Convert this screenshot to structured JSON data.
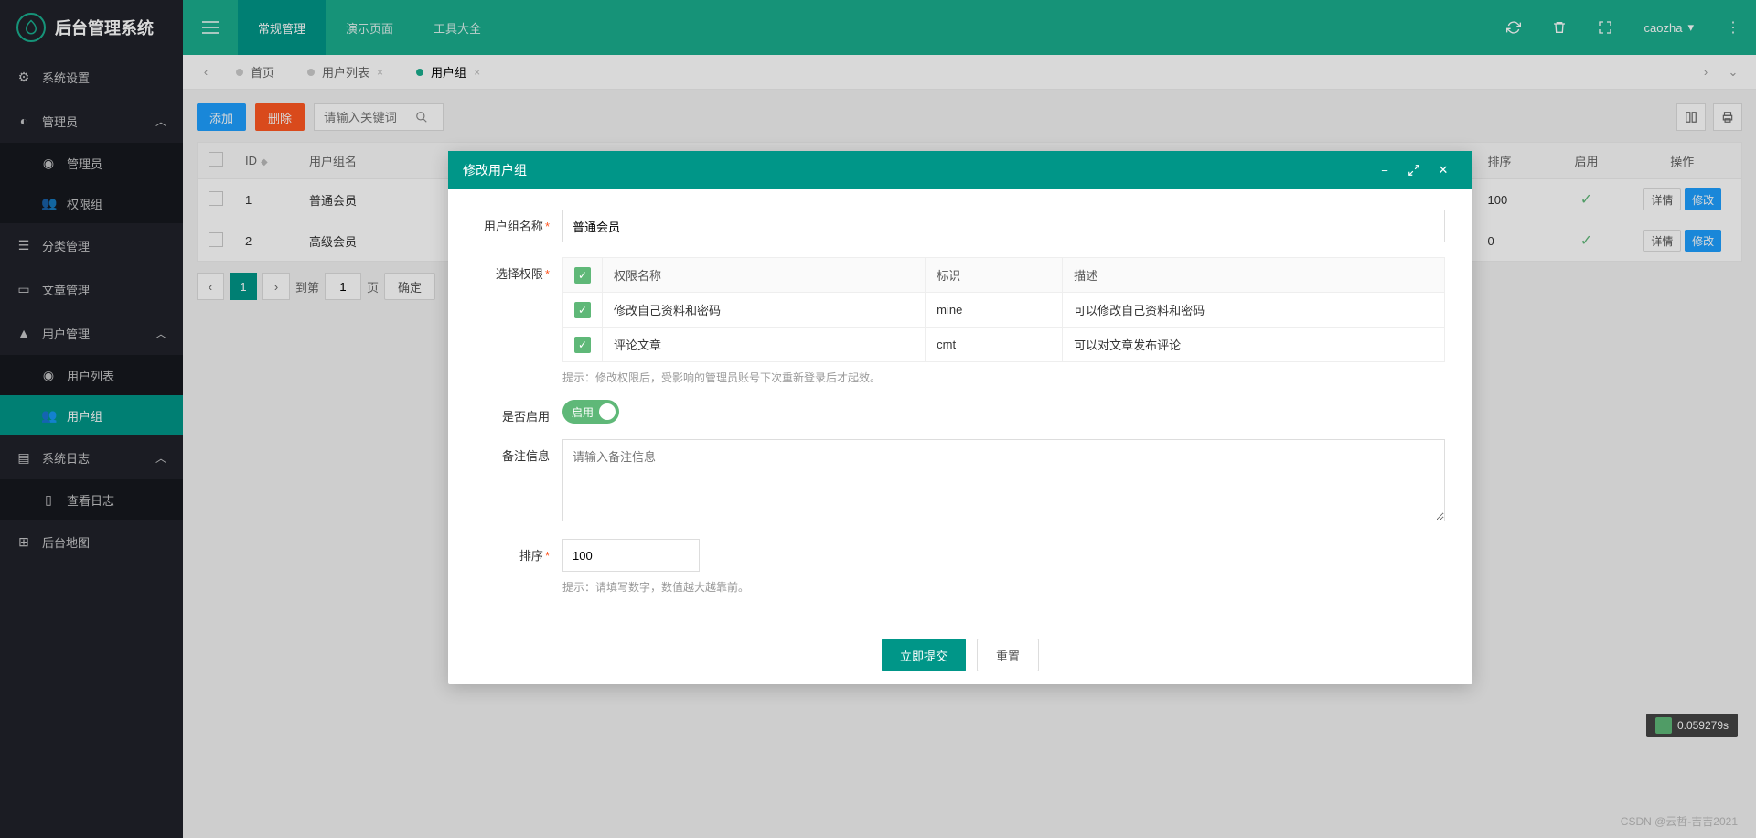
{
  "app": {
    "title": "后台管理系统"
  },
  "header": {
    "nav": [
      "常规管理",
      "演示页面",
      "工具大全"
    ],
    "user": "caozha"
  },
  "sidebar": {
    "items": [
      {
        "label": "系统设置",
        "icon": "gear"
      },
      {
        "label": "管理员",
        "icon": "user-circle",
        "expanded": true,
        "children": [
          {
            "label": "管理员"
          },
          {
            "label": "权限组"
          }
        ]
      },
      {
        "label": "分类管理",
        "icon": "list"
      },
      {
        "label": "文章管理",
        "icon": "doc"
      },
      {
        "label": "用户管理",
        "icon": "user",
        "expanded": true,
        "children": [
          {
            "label": "用户列表"
          },
          {
            "label": "用户组",
            "active": true
          }
        ]
      },
      {
        "label": "系统日志",
        "icon": "file",
        "expanded": true,
        "children": [
          {
            "label": "查看日志"
          }
        ]
      },
      {
        "label": "后台地图",
        "icon": "map"
      }
    ]
  },
  "tabs": {
    "items": [
      {
        "label": "首页",
        "closable": false
      },
      {
        "label": "用户列表",
        "closable": true
      },
      {
        "label": "用户组",
        "closable": true,
        "active": true
      }
    ]
  },
  "toolbar": {
    "add": "添加",
    "delete": "删除",
    "search_placeholder": "请输入关键词"
  },
  "table": {
    "headers": {
      "id": "ID",
      "name": "用户组名",
      "sort": "排序",
      "enabled": "启用",
      "ops": "操作"
    },
    "rows": [
      {
        "id": "1",
        "name": "普通会员",
        "sort": "100"
      },
      {
        "id": "2",
        "name": "高级会员",
        "sort": "0"
      }
    ],
    "ops": {
      "detail": "详情",
      "edit": "修改"
    }
  },
  "pagination": {
    "current": "1",
    "to": "到第",
    "page_unit": "页",
    "confirm": "确定"
  },
  "modal": {
    "title": "修改用户组",
    "labels": {
      "name": "用户组名称",
      "perm": "选择权限",
      "enabled": "是否启用",
      "remark": "备注信息",
      "sort": "排序"
    },
    "name_value": "普通会员",
    "perm_headers": {
      "name": "权限名称",
      "ident": "标识",
      "desc": "描述"
    },
    "perms": [
      {
        "name": "修改自己资料和密码",
        "ident": "mine",
        "desc": "可以修改自己资料和密码"
      },
      {
        "name": "评论文章",
        "ident": "cmt",
        "desc": "可以对文章发布评论"
      }
    ],
    "perm_hint": "提示：修改权限后，受影响的管理员账号下次重新登录后才起效。",
    "switch_on": "启用",
    "remark_placeholder": "请输入备注信息",
    "sort_value": "100",
    "sort_hint": "提示：请填写数字，数值越大越靠前。",
    "submit": "立即提交",
    "reset": "重置"
  },
  "perf": "0.059279s",
  "watermark": "CSDN @云哲-吉吉2021"
}
